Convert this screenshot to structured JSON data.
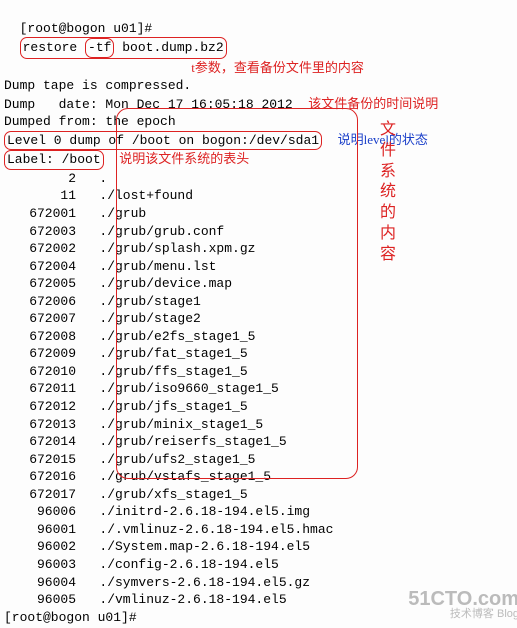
{
  "prompt1": {
    "user_host": "[root@bogon u01]#",
    "cmd_pre": "restore ",
    "flag": "-tf",
    "cmd_post": " boot.dump.bz2"
  },
  "annot": {
    "t_param": "t参数，查看备份文件里的内容",
    "time_desc": "该文件备份的时间说明",
    "level_desc": "说明level的状态",
    "label_desc": "说明该文件系统的表头",
    "vertical": "文件系统的内容"
  },
  "header": {
    "l1": "Dump tape is compressed.",
    "l2": "Dump   date: Mon Dec 17 16:05:18 2012",
    "l3": "Dumped from: the epoch",
    "l4": "Level 0 dump of /boot on bogon:/dev/sda1",
    "l5_label": "Label: /boot"
  },
  "rows": [
    {
      "n": "2",
      "p": "."
    },
    {
      "n": "11",
      "p": "./lost+found"
    },
    {
      "n": "672001",
      "p": "./grub"
    },
    {
      "n": "672003",
      "p": "./grub/grub.conf"
    },
    {
      "n": "672002",
      "p": "./grub/splash.xpm.gz"
    },
    {
      "n": "672004",
      "p": "./grub/menu.lst"
    },
    {
      "n": "672005",
      "p": "./grub/device.map"
    },
    {
      "n": "672006",
      "p": "./grub/stage1"
    },
    {
      "n": "672007",
      "p": "./grub/stage2"
    },
    {
      "n": "672008",
      "p": "./grub/e2fs_stage1_5"
    },
    {
      "n": "672009",
      "p": "./grub/fat_stage1_5"
    },
    {
      "n": "672010",
      "p": "./grub/ffs_stage1_5"
    },
    {
      "n": "672011",
      "p": "./grub/iso9660_stage1_5"
    },
    {
      "n": "672012",
      "p": "./grub/jfs_stage1_5"
    },
    {
      "n": "672013",
      "p": "./grub/minix_stage1_5"
    },
    {
      "n": "672014",
      "p": "./grub/reiserfs_stage1_5"
    },
    {
      "n": "672015",
      "p": "./grub/ufs2_stage1_5"
    },
    {
      "n": "672016",
      "p": "./grub/vstafs_stage1_5"
    },
    {
      "n": "672017",
      "p": "./grub/xfs_stage1_5"
    },
    {
      "n": "96006",
      "p": "./initrd-2.6.18-194.el5.img"
    },
    {
      "n": "96001",
      "p": "./.vmlinuz-2.6.18-194.el5.hmac"
    },
    {
      "n": "96002",
      "p": "./System.map-2.6.18-194.el5"
    },
    {
      "n": "96003",
      "p": "./config-2.6.18-194.el5"
    },
    {
      "n": "96004",
      "p": "./symvers-2.6.18-194.el5.gz"
    },
    {
      "n": "96005",
      "p": "./vmlinuz-2.6.18-194.el5"
    }
  ],
  "prompt2": "[root@bogon u01]#",
  "watermark": {
    "main": "51CTO.com",
    "sub": "技术博客          Blog"
  }
}
